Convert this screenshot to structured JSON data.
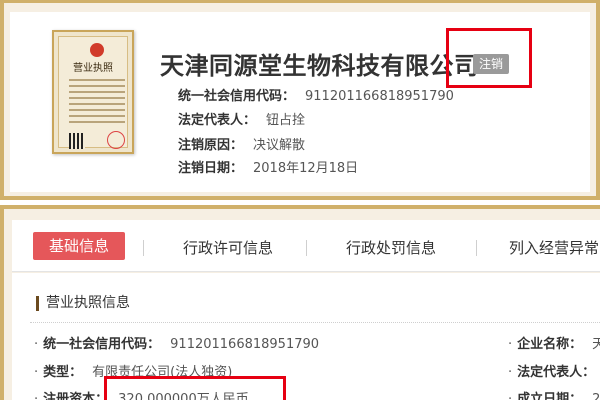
{
  "company": {
    "name": "天津同源堂生物科技有限公司",
    "status": "注销",
    "license_thumbnail_title": "营业执照"
  },
  "summary": [
    {
      "label": "统一社会信用代码：",
      "value": "911201166818951790"
    },
    {
      "label": "法定代表人：",
      "value": "钮占拴"
    },
    {
      "label": "注销原因：",
      "value": "决议解散"
    },
    {
      "label": "注销日期：",
      "value": "2018年12月18日"
    }
  ],
  "tabs": [
    {
      "label": "基础信息",
      "active": true
    },
    {
      "label": "行政许可信息",
      "active": false
    },
    {
      "label": "行政处罚信息",
      "active": false
    },
    {
      "label": "列入经营异常",
      "active": false
    }
  ],
  "section": {
    "title": "营业执照信息",
    "left_fields": [
      {
        "label": "统一社会信用代码：",
        "value": "911201166818951790"
      },
      {
        "label": "类型：",
        "value": "有限责任公司(法人独资)"
      },
      {
        "label": "注册资本：",
        "value": "320.000000万人民币"
      }
    ],
    "right_fields": [
      {
        "label": "企业名称：",
        "value": "天"
      },
      {
        "label": "法定代表人：",
        "value": ""
      },
      {
        "label": "成立日期：",
        "value": "2"
      }
    ]
  },
  "colors": {
    "frame_gold": "#d0b06a",
    "active_tab": "#e5575a",
    "status_badge": "#9a9a9a",
    "highlight_red": "#e60012"
  }
}
